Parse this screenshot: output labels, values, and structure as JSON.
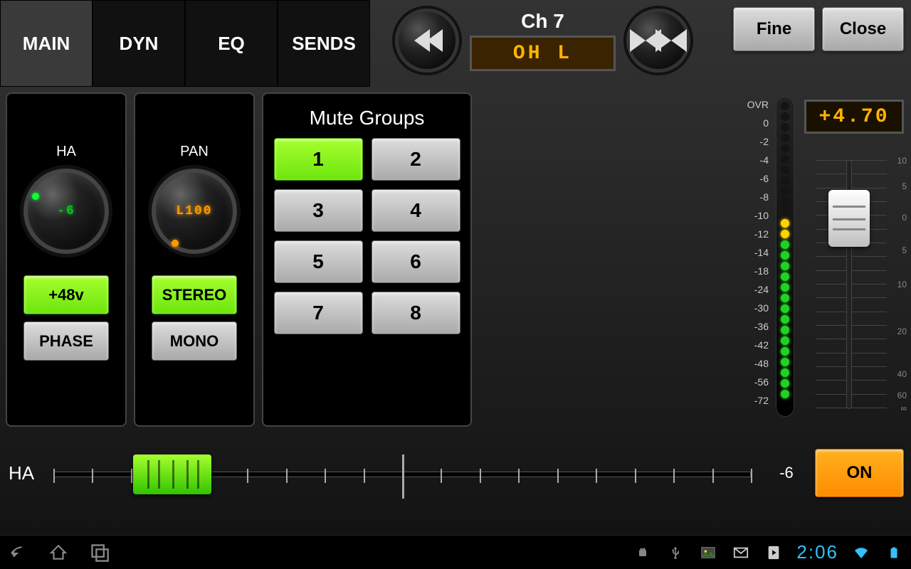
{
  "header": {
    "tabs": [
      "MAIN",
      "DYN",
      "EQ",
      "SENDS"
    ],
    "active_tab": 0,
    "channel_number": "Ch 7",
    "channel_name": "OH L",
    "fine_label": "Fine",
    "close_label": "Close"
  },
  "ha_panel": {
    "title": "HA",
    "display": "-6",
    "phantom_label": "+48v",
    "phase_label": "PHASE"
  },
  "pan_panel": {
    "title": "PAN",
    "display": "L100",
    "stereo_label": "STEREO",
    "mono_label": "MONO"
  },
  "mute_groups": {
    "title": "Mute Groups",
    "buttons": [
      "1",
      "2",
      "3",
      "4",
      "5",
      "6",
      "7",
      "8"
    ],
    "active": [
      true,
      false,
      false,
      false,
      false,
      false,
      false,
      false
    ]
  },
  "meter": {
    "labels": [
      "OVR",
      "0",
      "-2",
      "-4",
      "-6",
      "-8",
      "-10",
      "-12",
      "-14",
      "-18",
      "-24",
      "-30",
      "-36",
      "-42",
      "-48",
      "-56",
      "-72"
    ],
    "gain_display": "+4.70",
    "fader_scale": {
      "10": 0,
      "5": 36,
      "0": 80,
      "5b": 126,
      "10b": 174,
      "20": 240,
      "40": 300,
      "60": 330,
      "inf": 348
    },
    "fader_position_pct": 12
  },
  "bottom": {
    "label": "HA",
    "value": "-6",
    "position_pct": 17,
    "on_label": "ON"
  },
  "sysbar": {
    "clock": "2:06"
  }
}
